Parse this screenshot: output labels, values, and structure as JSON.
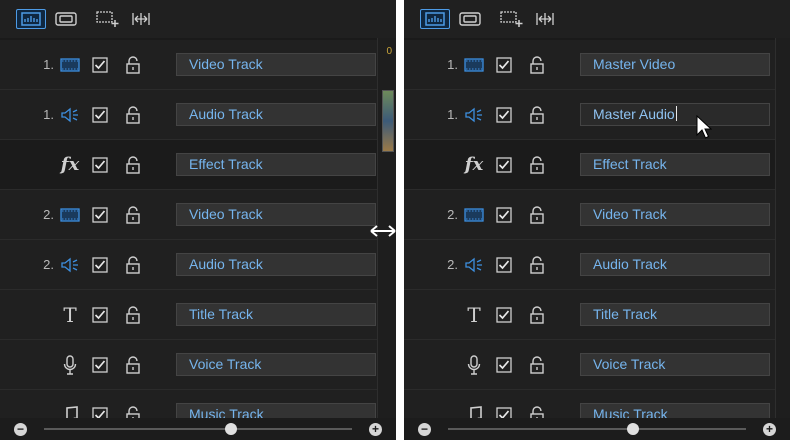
{
  "colors": {
    "panel_bg": "#1a1a1a",
    "row_bg": "#202020",
    "field_bg": "#333333",
    "label_blue": "#76b5ee",
    "icon_blue": "#3d8fe0",
    "icon_gray": "#cfcfcf",
    "active_toolbar_border": "#4d9be6"
  },
  "toolbar": {
    "buttons": [
      {
        "icon": "track-manager-icon",
        "active": true
      },
      {
        "icon": "display-mode-icon",
        "active": false
      },
      {
        "icon": "add-track-icon",
        "active": false
      },
      {
        "icon": "fit-timeline-icon",
        "active": false
      }
    ]
  },
  "timeline": {
    "time_fragment": "0"
  },
  "left_panel": {
    "tracks": [
      {
        "num": "1.",
        "icon": "video-track-icon",
        "checked": true,
        "locked": false,
        "name": "Video Track"
      },
      {
        "num": "1.",
        "icon": "audio-track-icon",
        "checked": true,
        "locked": false,
        "name": "Audio Track"
      },
      {
        "num": "",
        "icon": "fx-icon",
        "glyph": "fx",
        "checked": true,
        "locked": false,
        "name": "Effect Track"
      },
      {
        "num": "2.",
        "icon": "video-track-icon",
        "checked": true,
        "locked": false,
        "name": "Video Track"
      },
      {
        "num": "2.",
        "icon": "audio-track-icon",
        "checked": true,
        "locked": false,
        "name": "Audio Track"
      },
      {
        "num": "",
        "icon": "title-track-icon",
        "glyph": "T",
        "checked": true,
        "locked": false,
        "name": "Title Track"
      },
      {
        "num": "",
        "icon": "microphone-icon",
        "checked": true,
        "locked": false,
        "name": "Voice Track"
      },
      {
        "num": "",
        "icon": "music-note-icon",
        "checked": true,
        "locked": false,
        "name": "Music Track"
      }
    ]
  },
  "right_panel": {
    "tracks": [
      {
        "num": "1.",
        "icon": "video-track-icon",
        "checked": true,
        "locked": false,
        "name": "Master Video"
      },
      {
        "num": "1.",
        "icon": "audio-track-icon",
        "checked": true,
        "locked": false,
        "name": "Master Audio",
        "editing": true
      },
      {
        "num": "",
        "icon": "fx-icon",
        "glyph": "fx",
        "checked": true,
        "locked": false,
        "name": "Effect Track"
      },
      {
        "num": "2.",
        "icon": "video-track-icon",
        "checked": true,
        "locked": false,
        "name": "Video Track"
      },
      {
        "num": "2.",
        "icon": "audio-track-icon",
        "checked": true,
        "locked": false,
        "name": "Audio Track"
      },
      {
        "num": "",
        "icon": "title-track-icon",
        "glyph": "T",
        "checked": true,
        "locked": false,
        "name": "Title Track"
      },
      {
        "num": "",
        "icon": "microphone-icon",
        "checked": true,
        "locked": false,
        "name": "Voice Track"
      },
      {
        "num": "",
        "icon": "music-note-icon",
        "checked": true,
        "locked": false,
        "name": "Music Track"
      }
    ]
  },
  "zoom": {
    "minus": "−",
    "plus": "+",
    "level": 0.5
  }
}
